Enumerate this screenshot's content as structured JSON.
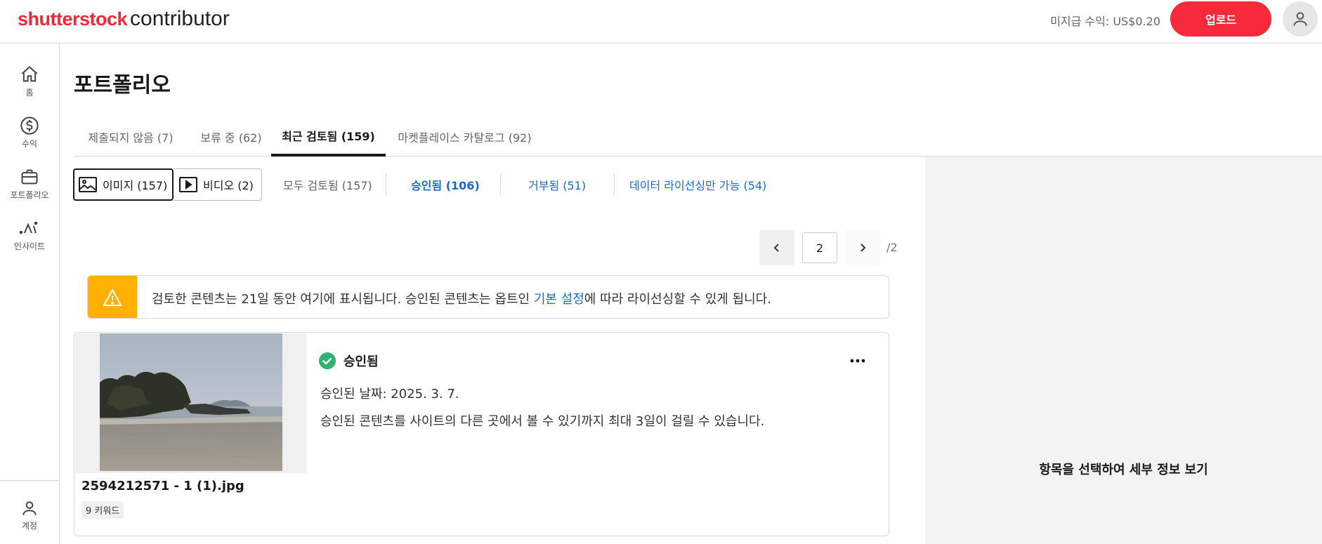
{
  "header": {
    "logo_brand": "shutterstock",
    "logo_product": "contributor",
    "earnings_label": "미지급 수익: US$0.20",
    "upload_label": "업로드",
    "account_icon": "user-icon",
    "brand_color": "#f72a3b"
  },
  "sidebar": {
    "items": [
      {
        "label": "홈",
        "icon": "home-icon"
      },
      {
        "label": "수익",
        "icon": "dollar-circle-icon"
      },
      {
        "label": "포트폴리오",
        "icon": "briefcase-icon"
      },
      {
        "label": "인사이트",
        "icon": "insights-icon"
      }
    ],
    "account": {
      "label": "계정",
      "icon": "user-icon"
    }
  },
  "main": {
    "title": "포트폴리오",
    "tabs": [
      {
        "label": "제출되지 않음 (7)",
        "active": false
      },
      {
        "label": "보류 중 (62)",
        "active": false
      },
      {
        "label": "최근 검토됨 (159)",
        "active": true
      },
      {
        "label": "마켓플레이스 카탈로그 (92)",
        "active": false
      }
    ],
    "media_toggle": [
      {
        "label": "이미지 (157)",
        "icon": "image-icon",
        "selected": true
      },
      {
        "label": "비디오 (2)",
        "icon": "video-icon",
        "selected": false
      }
    ],
    "filters": [
      {
        "label": "모두 검토됨 (157)",
        "style": "gray"
      },
      {
        "label": "승인됨 (106)",
        "style": "blue-bold"
      },
      {
        "label": "거부됨 (51)",
        "style": "blue"
      },
      {
        "label": "데이터 라이선싱만 가능 (54)",
        "style": "blue"
      }
    ],
    "pagination": {
      "current_page": "2",
      "total_label": "/2"
    },
    "alert": {
      "text_before": "검토한 콘텐츠는 21일 동안 여기에 표시됩니다. 승인된 콘텐츠는 옵트인 ",
      "link_text": "기본 설정",
      "text_after": "에 따라 라이선싱할 수 있게 됩니다.",
      "accent_color": "#ffb000"
    },
    "item": {
      "filename": "2594212571 - 1 (1).jpg",
      "keywords_badge": "9 키워드",
      "status": "승인됨",
      "status_color": "#2db36f",
      "approved_date": "승인된 날짜: 2025. 3. 7.",
      "approval_note": "승인된 콘텐츠를 사이트의 다른 곳에서 볼 수 있기까지 최대 3일이 걸릴 수 있습니다."
    }
  },
  "details_panel": {
    "placeholder": "항목을 선택하여 세부 정보 보기"
  }
}
